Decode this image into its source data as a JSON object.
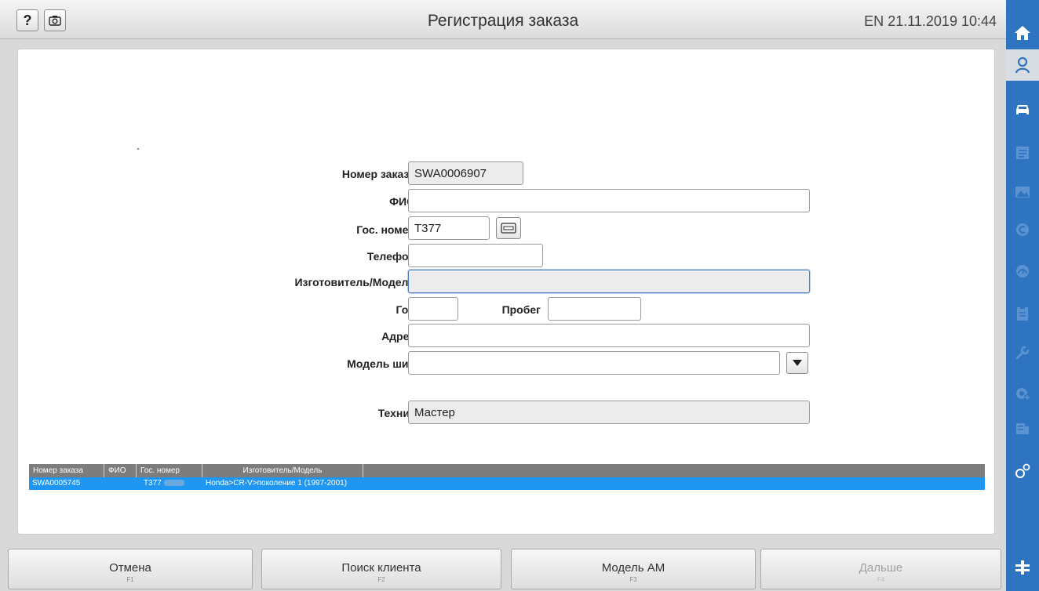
{
  "header": {
    "help_label": "?",
    "title": "Регистрация заказа",
    "lang": "EN",
    "datetime": "21.11.2019 10:44"
  },
  "form": {
    "order_number": {
      "label": "Номер заказа",
      "value": "SWA0006907"
    },
    "full_name": {
      "label": "ФИО",
      "value": ""
    },
    "plate": {
      "label": "Гос. номер",
      "value": "T377"
    },
    "phone": {
      "label": "Телефон",
      "value": ""
    },
    "make_model": {
      "label": "Изготовитель/Модель",
      "value": ""
    },
    "year": {
      "label": "Год",
      "value": ""
    },
    "mileage": {
      "label": "Пробег",
      "value": ""
    },
    "address": {
      "label": "Адрес",
      "value": ""
    },
    "tire_model": {
      "label": "Модель шин",
      "value": ""
    },
    "technician": {
      "label": "Техник",
      "value": "Мастер"
    }
  },
  "table": {
    "columns": [
      "Номер заказа",
      "ФИО",
      "Гос. номер",
      "Изготовитель/Модель"
    ],
    "rows": [
      {
        "order": "SWA0005745",
        "name": "",
        "plate": "T377",
        "model": "Honda>CR-V>поколение 1 (1997-2001)"
      }
    ]
  },
  "buttons": {
    "cancel": {
      "label": "Отмена",
      "key": "F1"
    },
    "search_client": {
      "label": "Поиск клиента",
      "key": "F2"
    },
    "model_am": {
      "label": "Модель АМ",
      "key": "F3"
    },
    "next": {
      "label": "Дальше",
      "key": "F4"
    }
  },
  "sidebar": {
    "icons": [
      "home-icon",
      "customer-icon",
      "car-icon",
      "document-icon",
      "image-icon",
      "c-circle-icon",
      "gauge-icon",
      "clipboard-icon",
      "wrench-icon",
      "add-gear-icon",
      "report-icon",
      "settings-icon",
      "lift-icon"
    ],
    "active": "customer-icon"
  },
  "colors": {
    "sidebar": "#2f74c0",
    "selected_row": "#1f97f2",
    "header_row": "#7d7d7d"
  }
}
